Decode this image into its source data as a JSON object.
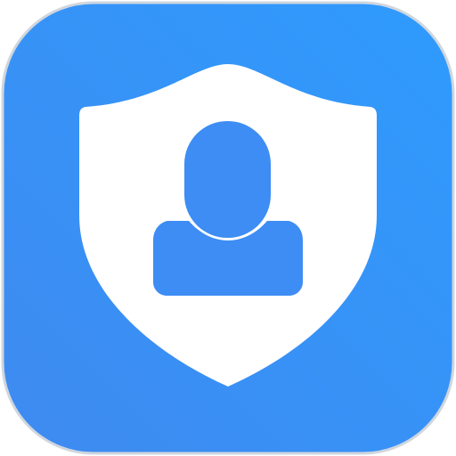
{
  "icon": {
    "name": "shield-user-icon",
    "colors": {
      "background_light": "#2f9bfd",
      "background_dark": "#3f8af0",
      "border": "#cfd6df",
      "shield": "#ffffff",
      "figure": "#3d8df4"
    }
  }
}
